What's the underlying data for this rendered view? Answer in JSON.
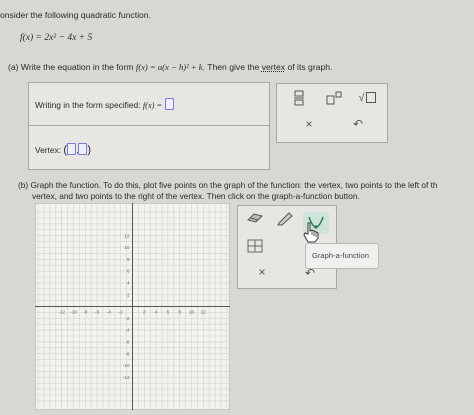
{
  "header": {
    "consider_text": "onsider the following quadratic function.",
    "function_expr": "f(x) = 2x² − 4x + 5"
  },
  "part_a": {
    "prompt_prefix": "(a) Write the equation in the form",
    "form_expr": "f(x) = a(x − h)² + k",
    "prompt_middle": ". Then give the",
    "vertex_link": "vertex",
    "prompt_suffix": "of its graph.",
    "writing_label": "Writing in the form specified:",
    "writing_fx": "f(x) =",
    "vertex_label": "Vertex:",
    "keypad": {
      "fraction": "fraction",
      "superscript": "superscript",
      "sqrt": "√",
      "clear": "×",
      "undo": "↶"
    }
  },
  "part_b": {
    "prompt_line1": "(b) Graph the function. To do this, plot five points on the graph of the function: the vertex, two points to the left of th",
    "prompt_line2": "vertex, and two points to the right of the vertex. Then click on the graph-a-function button.",
    "tooltip": "Graph-a-function",
    "tools": {
      "clear": "×",
      "undo": "↶"
    }
  },
  "graph": {
    "x_ticks": [
      "-12",
      "-10",
      "-8",
      "-6",
      "-4",
      "-2",
      "2",
      "4",
      "6",
      "8",
      "10",
      "12"
    ],
    "y_ticks": [
      "12",
      "10",
      "8",
      "6",
      "4",
      "2",
      "-2",
      "-4",
      "-6",
      "-8",
      "-10",
      "-12"
    ]
  }
}
